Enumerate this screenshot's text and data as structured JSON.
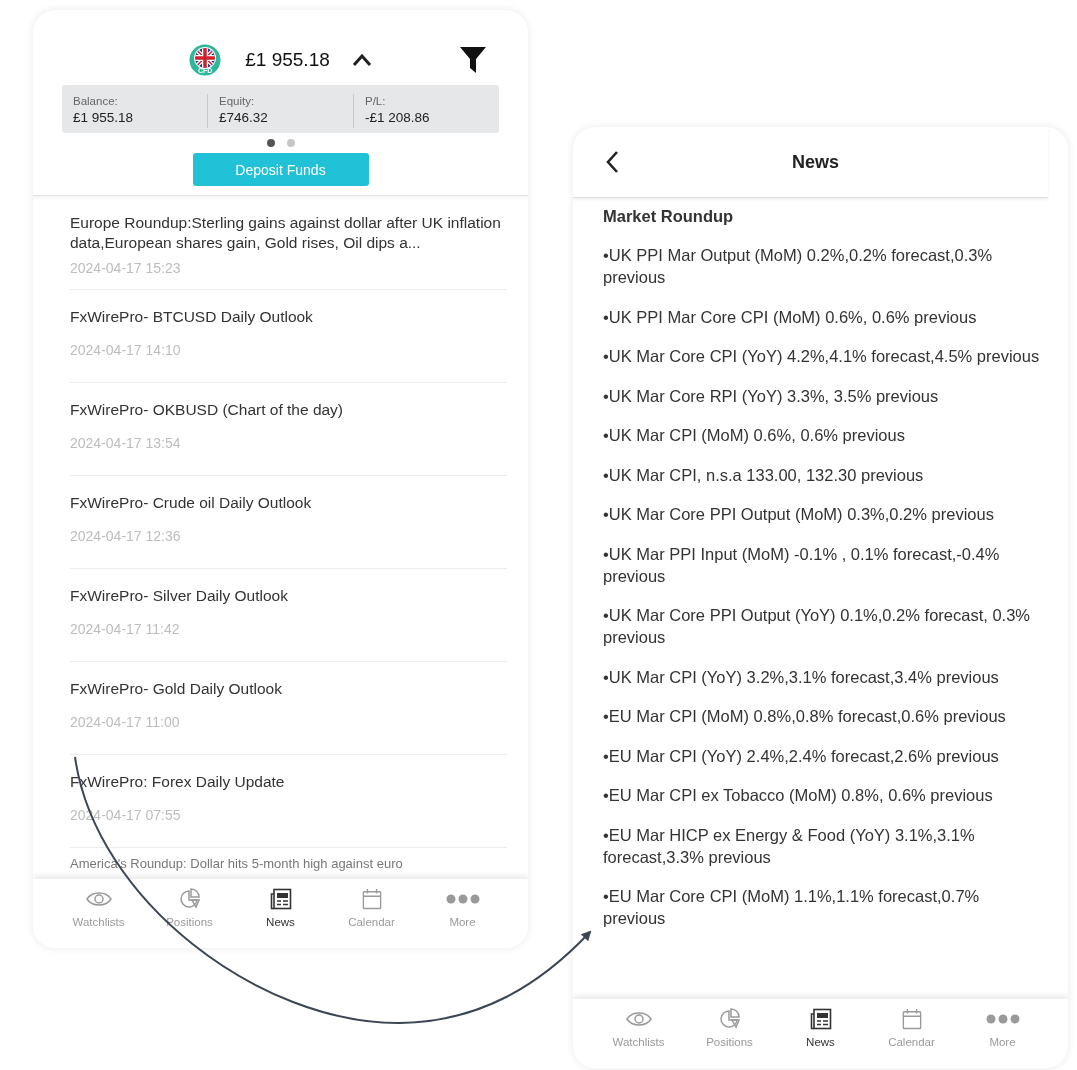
{
  "left_screen": {
    "header": {
      "flag_badge": "CFD",
      "amount": "£1 955.18",
      "expanded": true
    },
    "summary": [
      {
        "label": "Balance:",
        "value": "£1 955.18"
      },
      {
        "label": "Equity:",
        "value": "£746.32"
      },
      {
        "label": "P/L:",
        "value": "-£1 208.86"
      }
    ],
    "pages": [
      {
        "selected": true
      },
      {
        "selected": false
      }
    ],
    "deposit_button": "Deposit Funds",
    "news": [
      {
        "title": "Europe  Roundup:Sterling gains against dollar after UK inflation data,European shares gain, Gold rises, Oil dips a...",
        "time": "2024-04-17 15:23"
      },
      {
        "title": "FxWirePro- BTCUSD Daily Outlook",
        "time": "2024-04-17 14:10"
      },
      {
        "title": "FxWirePro- OKBUSD (Chart of the day)",
        "time": "2024-04-17 13:54"
      },
      {
        "title": "FxWirePro- Crude oil Daily Outlook",
        "time": "2024-04-17 12:36"
      },
      {
        "title": "FxWirePro- Silver Daily Outlook",
        "time": "2024-04-17 11:42"
      },
      {
        "title": "FxWirePro- Gold Daily Outlook",
        "time": "2024-04-17 11:00"
      },
      {
        "title": "FxWirePro: Forex Daily Update",
        "time": "2024-04-17 07:55"
      },
      {
        "title": "America's Roundup: Dollar hits 5-month high against euro"
      }
    ],
    "tab_bar": [
      {
        "label": "Watchlists",
        "selected": false
      },
      {
        "label": "Positions",
        "selected": false
      },
      {
        "label": "News",
        "selected": true
      },
      {
        "label": "Calendar",
        "selected": false
      },
      {
        "label": "More",
        "selected": false
      }
    ]
  },
  "right_screen": {
    "title": "News",
    "heading": "Market Roundup",
    "lines": [
      "•UK PPI Mar Output (MoM) 0.2%,0.2% forecast,0.3% previous",
      "•UK PPI Mar Core CPI (MoM)  0.6%, 0.6% previous",
      "•UK Mar Core CPI (YoY)  4.2%,4.1% forecast,4.5% previous",
      "•UK Mar Core RPI (YoY) 3.3%, 3.5% previous",
      "•UK Mar CPI (MoM)  0.6%, 0.6% previous",
      "•UK Mar CPI, n.s.a  133.00, 132.30 previous",
      "•UK Mar Core PPI Output (MoM) 0.3%,0.2% previous",
      "•UK Mar PPI Input (MoM) -0.1%  , 0.1% forecast,-0.4% previous",
      "•UK Mar Core PPI Output (YoY)  0.1%,0.2% forecast, 0.3% previous",
      "•UK Mar CPI (YoY)  3.2%,3.1% forecast,3.4% previous",
      "•EU Mar CPI (MoM)  0.8%,0.8% forecast,0.6% previous",
      "•EU Mar CPI (YoY)  2.4%,2.4% forecast,2.6% previous",
      "•EU Mar CPI ex Tobacco (MoM)  0.8%,  0.6% previous",
      "•EU Mar HICP ex Energy & Food (YoY) 3.1%,3.1% forecast,3.3% previous",
      "•EU Mar Core CPI (MoM) 1.1%,1.1% forecast,0.7% previous"
    ],
    "tab_bar": [
      {
        "label": "Watchlists",
        "selected": false
      },
      {
        "label": "Positions",
        "selected": false
      },
      {
        "label": "News",
        "selected": true
      },
      {
        "label": "Calendar",
        "selected": false
      },
      {
        "label": "More",
        "selected": false
      }
    ]
  }
}
